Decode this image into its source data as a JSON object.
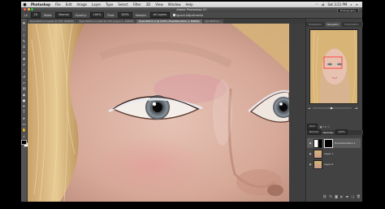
{
  "menubar": {
    "apple_icon": "",
    "items": [
      "Photoshop",
      "File",
      "Edit",
      "Image",
      "Layer",
      "Type",
      "Select",
      "Filter",
      "3D",
      "View",
      "Window",
      "Help"
    ],
    "clock": "Sat 3:21 PM",
    "status_icons": [
      "wifi-icon",
      "volume-icon",
      "search-icon",
      "list-icon"
    ]
  },
  "titlebar": {
    "title": "Adobe Photoshop CC",
    "workspace": "Photography",
    "traffic_colors": [
      "#ff5f57",
      "#febc2e",
      "#28c840"
    ]
  },
  "options": {
    "brush_size": "20",
    "mode_label": "Mode:",
    "mode_value": "Normal",
    "opacity_label": "Opacity:",
    "opacity_value": "100%",
    "flow_label": "Flow:",
    "flow_value": "100%",
    "sample_label": "Sample:",
    "sample_value": "All Layers",
    "ignore_label": "Ignore Adjustments"
  },
  "tabs": [
    {
      "label": "Eyes Before Crystal @ 33% (RGB/8)",
      "active": false
    },
    {
      "label": "Eyes Before Crystal @ 33% (Layer 1, RGB/8)",
      "active": false
    },
    {
      "label": "Eyes Before 2 @ 100% (Hue/Saturation 1, RGB/8)",
      "active": true
    },
    {
      "label": "Eye Before...",
      "active": false
    }
  ],
  "tools": [
    {
      "name": "move-tool-icon",
      "glyph": "✥"
    },
    {
      "name": "marquee-tool-icon",
      "glyph": "⬚"
    },
    {
      "name": "lasso-tool-icon",
      "glyph": "⌇"
    },
    {
      "name": "quick-select-tool-icon",
      "glyph": "✎"
    },
    {
      "name": "crop-tool-icon",
      "glyph": "⌗"
    },
    {
      "name": "eyedropper-tool-icon",
      "glyph": "⌖"
    },
    {
      "name": "healing-brush-tool-icon",
      "glyph": "✚"
    },
    {
      "name": "brush-tool-icon",
      "glyph": "✐"
    },
    {
      "name": "clone-stamp-tool-icon",
      "glyph": "⊥"
    },
    {
      "name": "history-brush-tool-icon",
      "glyph": "↺"
    },
    {
      "name": "eraser-tool-icon",
      "glyph": "▱"
    },
    {
      "name": "gradient-tool-icon",
      "glyph": "▤"
    },
    {
      "name": "blur-tool-icon",
      "glyph": "◆"
    },
    {
      "name": "dodge-tool-icon",
      "glyph": "●"
    },
    {
      "name": "pen-tool-icon",
      "glyph": "✒"
    },
    {
      "name": "type-tool-icon",
      "glyph": "T"
    },
    {
      "name": "path-select-tool-icon",
      "glyph": "➤"
    },
    {
      "name": "shape-tool-icon",
      "glyph": "▭"
    },
    {
      "name": "hand-tool-icon",
      "glyph": "✋"
    },
    {
      "name": "zoom-tool-icon",
      "glyph": "⌕"
    }
  ],
  "navigator": {
    "tabs": [
      "Histogram",
      "Navigator",
      "Information"
    ],
    "active_tab": "Navigator",
    "zoom": "100%"
  },
  "layers": {
    "tabs": [
      "Layers",
      "Channels",
      "Paths"
    ],
    "kind_label": "Kind",
    "blend_mode": "Normal",
    "opacity_label": "Opacity:",
    "opacity_value": "100%",
    "lock_label": "Lock:",
    "fill_label": "Fill:",
    "fill_value": "100%",
    "items": [
      {
        "name": "Hue/Saturation 1",
        "type": "adjustment",
        "selected": true
      },
      {
        "name": "Layer 1",
        "type": "pixel",
        "selected": false
      },
      {
        "name": "Layer 0",
        "type": "pixel",
        "selected": false
      }
    ],
    "footer_icons": [
      "link-icon",
      "fx-icon",
      "mask-icon",
      "adjustment-icon",
      "folder-icon",
      "new-layer-icon",
      "trash-icon"
    ]
  }
}
